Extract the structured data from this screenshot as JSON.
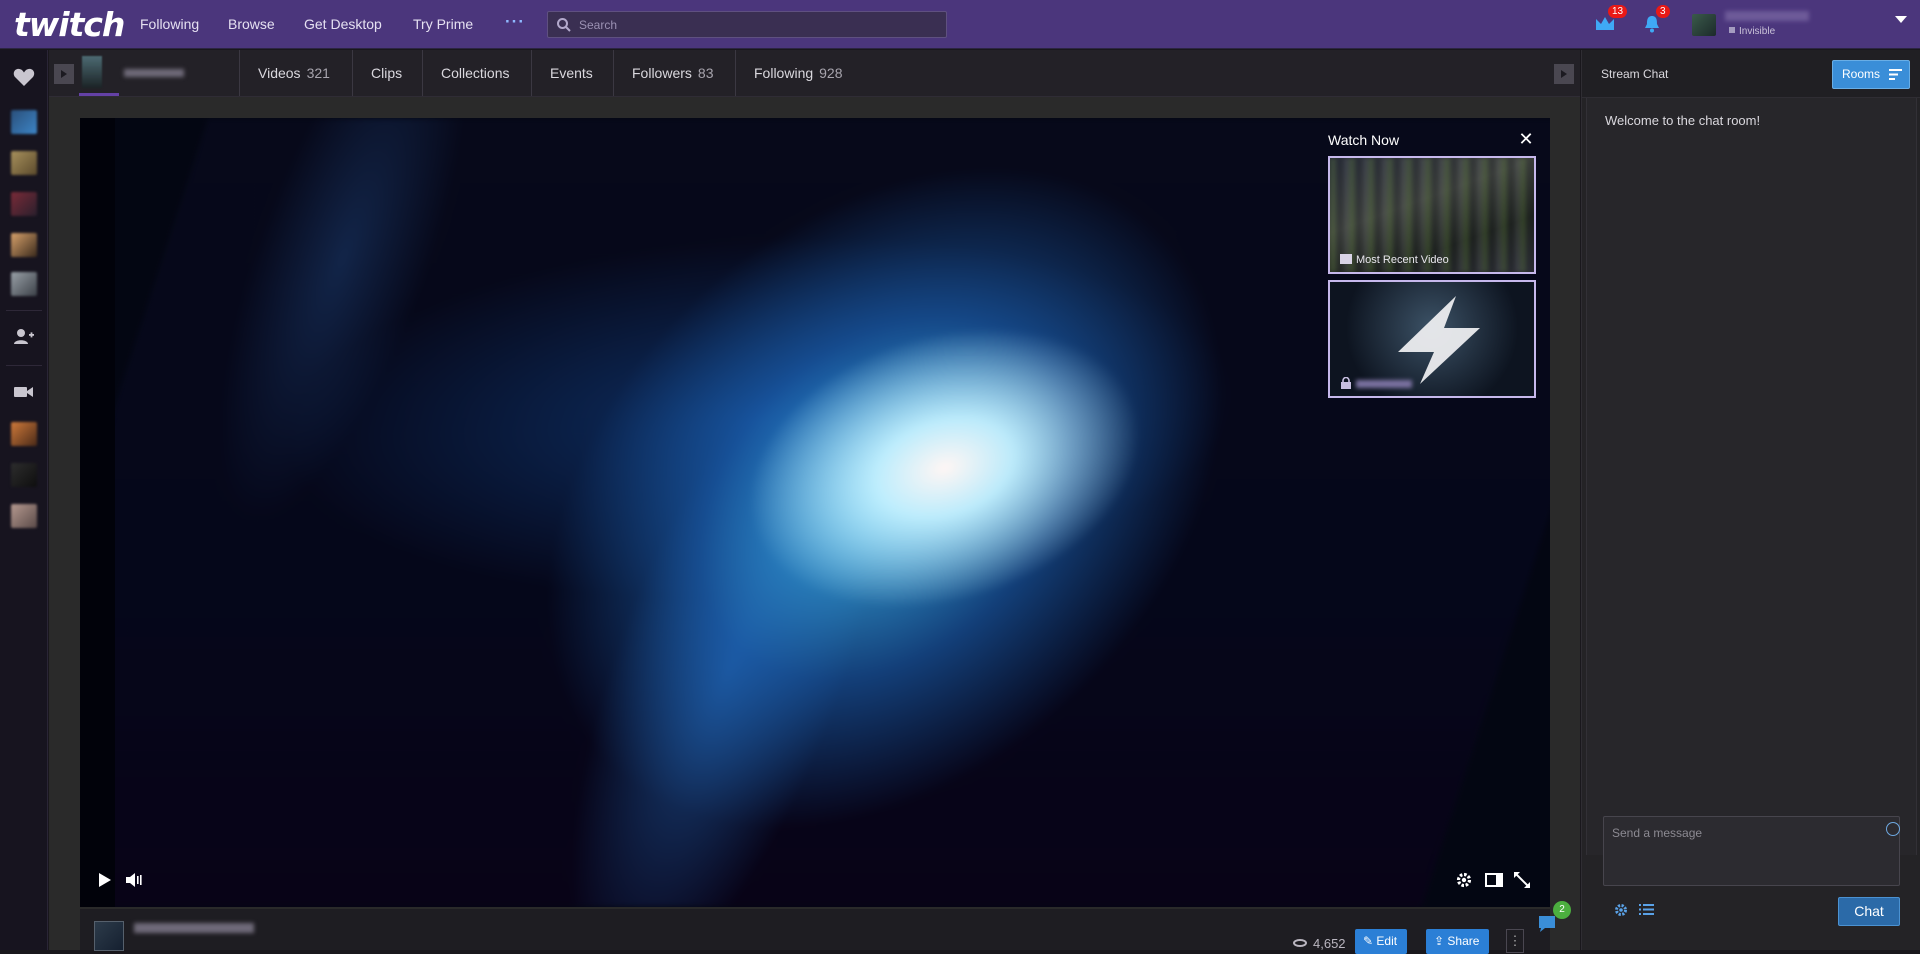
{
  "topnav": {
    "logo": "twitch",
    "links": [
      "Following",
      "Browse",
      "Get Desktop",
      "Try Prime"
    ],
    "more": "···",
    "search_placeholder": "Search",
    "prime_badge": "13",
    "notif_badge": "3",
    "user_status": "Invisible",
    "colors": {
      "bar": "#4b367c",
      "badge": "#e91916"
    }
  },
  "leftrail": {
    "icons": [
      "heart-icon",
      "channel-thumb",
      "channel-thumb",
      "channel-thumb",
      "channel-thumb",
      "channel-thumb",
      "friends-icon",
      "video-camera-icon",
      "channel-thumb",
      "channel-thumb",
      "channel-thumb"
    ]
  },
  "channel": {
    "tabs": [
      {
        "label": "Videos",
        "count": "321"
      },
      {
        "label": "Clips",
        "count": ""
      },
      {
        "label": "Collections",
        "count": ""
      },
      {
        "label": "Events",
        "count": ""
      },
      {
        "label": "Followers",
        "count": "83"
      },
      {
        "label": "Following",
        "count": "928"
      }
    ]
  },
  "watchnow": {
    "title": "Watch Now",
    "close": "✕",
    "card1_label": "Most Recent Video"
  },
  "below": {
    "views": "4,652",
    "edit_label": "Edit",
    "share_label": "Share",
    "more": "⋮"
  },
  "chat": {
    "title": "Stream Chat",
    "rooms_label": "Rooms",
    "welcome": "Welcome to the chat room!",
    "input_placeholder": "Send a message",
    "send_label": "Chat",
    "bubble_count": "2",
    "accent": "#3a8ed8"
  }
}
